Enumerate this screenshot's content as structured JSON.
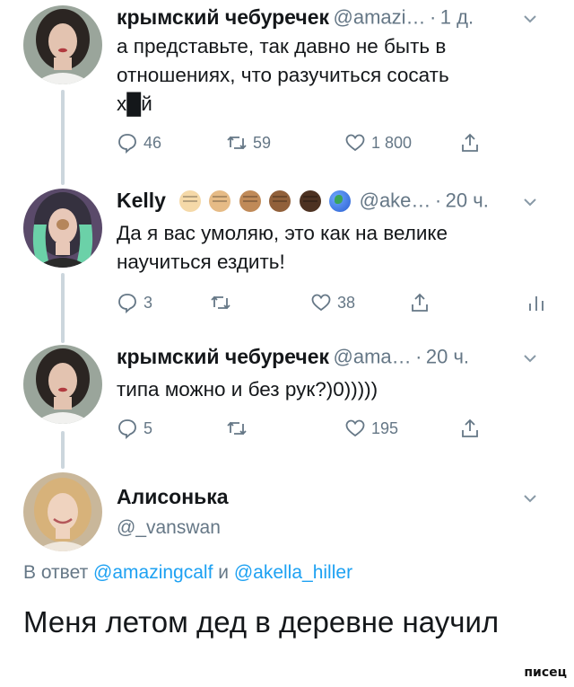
{
  "tweets": [
    {
      "name": "крымский чебуречек",
      "handle": "@amazi…",
      "time": "1 д.",
      "text": "а представьте, так давно не быть в\nотношениях, что разучиться сосать\nх█й",
      "actions": {
        "reply": "46",
        "retweet": "59",
        "like": "1 800"
      }
    },
    {
      "name": "Kelly",
      "handle": "@ake…",
      "time": "20 ч.",
      "text": "Да я вас умоляю, это как на велике\nнаучиться ездить!",
      "actions": {
        "reply": "3",
        "retweet": "",
        "like": "38"
      },
      "name_emojis": [
        "fist-light-icon",
        "fist-medium-light-icon",
        "fist-medium-icon",
        "fist-medium-dark-icon",
        "fist-dark-icon",
        "globe-icon"
      ]
    },
    {
      "name": "крымский чебуречек",
      "handle": "@ama…",
      "time": "20 ч.",
      "text": "типа можно и без рук?)0)))))",
      "actions": {
        "reply": "5",
        "retweet": "",
        "like": "195"
      }
    }
  ],
  "focus_tweet": {
    "name": "Алисонька",
    "handle": "@_vanswan",
    "reply_prefix": "В ответ",
    "mention_1": "@amazingcalf",
    "conjunction": "и",
    "mention_2": "@akella_hiller",
    "text": "Меня летом дед в деревне научил"
  },
  "separator": "·",
  "watermark": "писец",
  "colors": {
    "text": "#14171a",
    "muted": "#657786",
    "link": "#1da1f2",
    "thread_line": "#ccd6dd"
  }
}
